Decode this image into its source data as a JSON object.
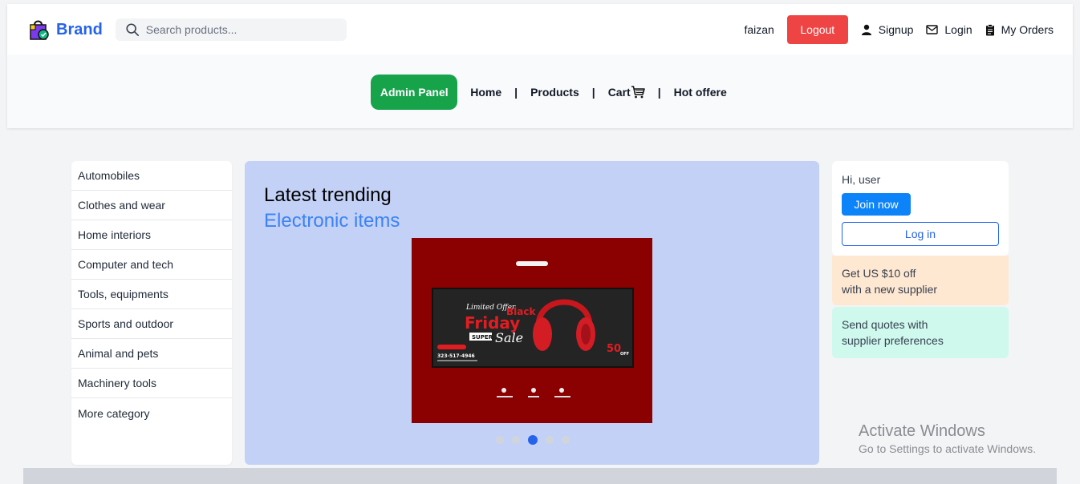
{
  "header": {
    "brand": "Brand",
    "search_placeholder": "Search products...",
    "username": "faizan",
    "logout_label": "Logout",
    "signup_label": "Signup",
    "login_label": "Login",
    "orders_label": "My Orders"
  },
  "nav": {
    "admin_label": "Admin Panel",
    "home": "Home",
    "products": "Products",
    "cart": "Cart",
    "cart_icon": "cart-icon",
    "hot_offers": "Hot offere",
    "separator": "|"
  },
  "categories": [
    "Automobiles",
    "Clothes and wear",
    "Home interiors",
    "Computer and tech",
    "Tools, equipments",
    "Sports and outdoor",
    "Animal and pets",
    "Machinery tools",
    "More category"
  ],
  "hero": {
    "title": "Latest trending",
    "subtitle": "Electronic items",
    "banner_image": "black-friday-headphones-banner",
    "slides_count": 5,
    "active_slide": 3
  },
  "aside": {
    "greeting": "Hi, user",
    "join_label": "Join now",
    "login_label": "Log in",
    "promo1_line1": "Get US $10 off",
    "promo1_line2": "with a new supplier",
    "promo2_line1": "Send quotes with",
    "promo2_line2": "supplier preferences"
  },
  "watermark": {
    "line1": "Activate Windows",
    "line2": "Go to Settings to activate Windows."
  },
  "colors": {
    "brand": "#2563eb",
    "logout": "#ef4444",
    "admin": "#16a34a",
    "hero_bg": "#c3d1f7",
    "promo1": "#ffe8d1",
    "promo2": "#cef9ec"
  }
}
